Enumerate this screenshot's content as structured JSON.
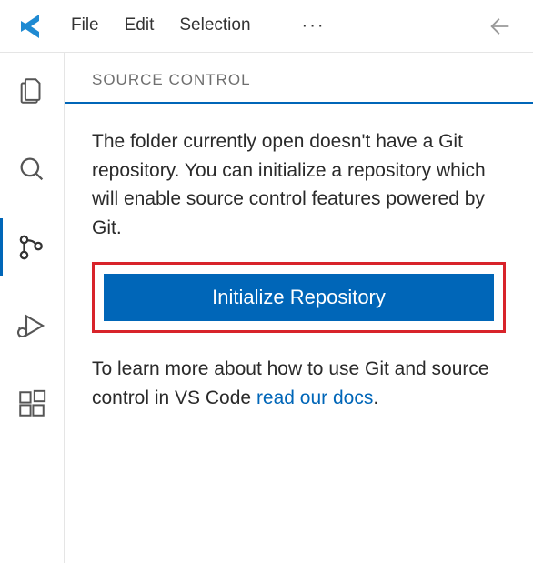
{
  "menu": {
    "file": "File",
    "edit": "Edit",
    "selection": "Selection",
    "more": "···"
  },
  "sidebar": {
    "title": "SOURCE CONTROL"
  },
  "scm": {
    "intro_text": "The folder currently open doesn't have a Git repository. You can initialize a repository which will enable source control features powered by Git.",
    "init_button_label": "Initialize Repository",
    "learn_prefix": "To learn more about how to use Git and source control in VS Code ",
    "learn_link": "read our docs",
    "learn_suffix": "."
  },
  "colors": {
    "accent": "#0066b8",
    "highlight": "#d8232a"
  }
}
